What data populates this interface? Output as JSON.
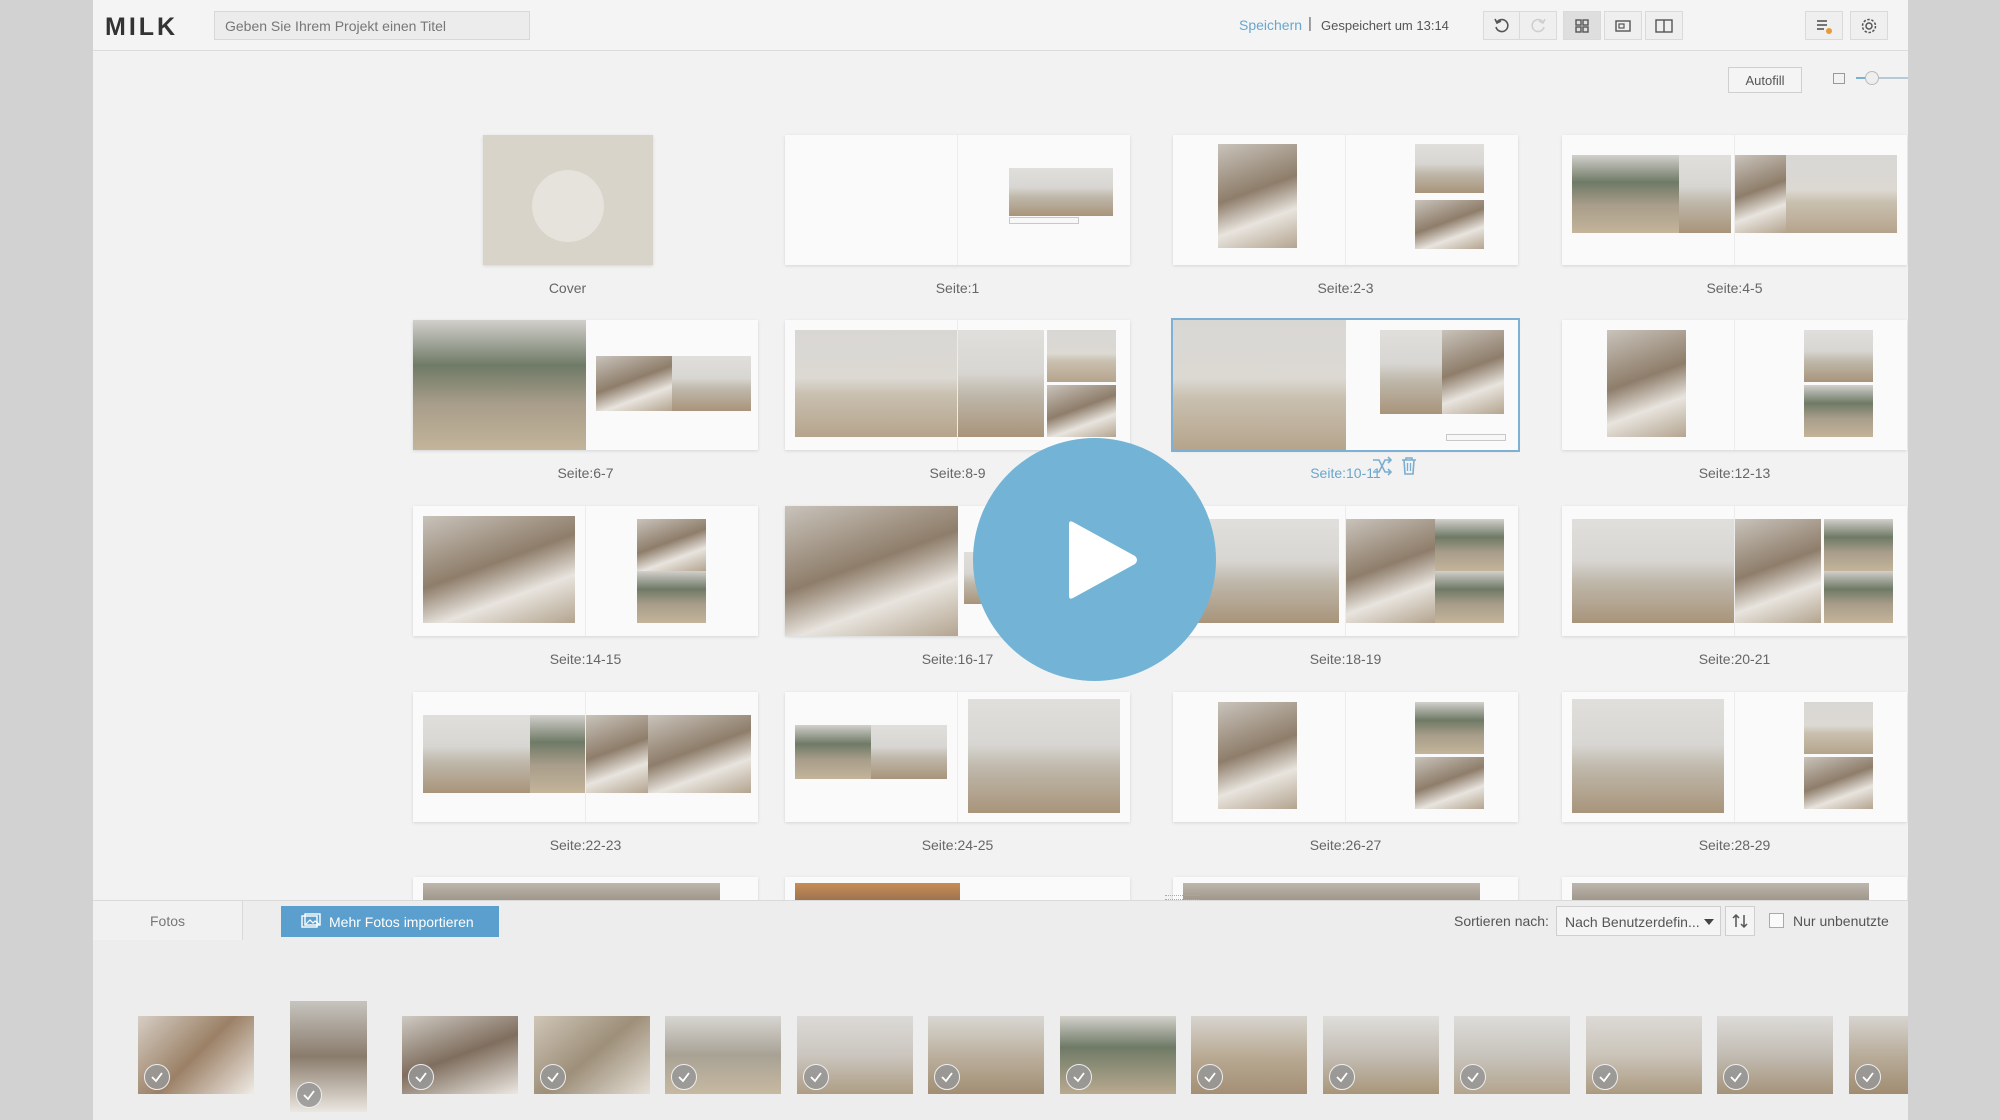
{
  "app": {
    "logo": "MILK",
    "title_placeholder": "Geben Sie Ihrem Projekt einen Titel",
    "save_label": "Speichern",
    "save_separator": "|",
    "saved_status": "Gespeichert um 13:14"
  },
  "toolbar": {
    "autofill_label": "Autofill",
    "zoom_level": 0.3
  },
  "spreads": [
    {
      "label": "Cover",
      "selected": false
    },
    {
      "label": "Seite:1",
      "selected": false
    },
    {
      "label": "Seite:2-3",
      "selected": false
    },
    {
      "label": "Seite:4-5",
      "selected": false
    },
    {
      "label": "Seite:6-7",
      "selected": false
    },
    {
      "label": "Seite:8-9",
      "selected": false
    },
    {
      "label": "Seite:10-11",
      "selected": true
    },
    {
      "label": "Seite:12-13",
      "selected": false
    },
    {
      "label": "Seite:14-15",
      "selected": false
    },
    {
      "label": "Seite:16-17",
      "selected": false
    },
    {
      "label": "Seite:18-19",
      "selected": false
    },
    {
      "label": "Seite:20-21",
      "selected": false
    },
    {
      "label": "Seite:22-23",
      "selected": false
    },
    {
      "label": "Seite:24-25",
      "selected": false
    },
    {
      "label": "Seite:26-27",
      "selected": false
    },
    {
      "label": "Seite:28-29",
      "selected": false
    }
  ],
  "panel": {
    "tab_label": "Fotos",
    "import_label": "Mehr Fotos importieren",
    "sort_label": "Sortieren nach:",
    "sort_value": "Nach Benutzerdefin...",
    "unused_only_label": "Nur unbenutzte",
    "unused_only_checked": false
  },
  "colors": {
    "accent": "#6aa6cc",
    "import_button": "#5a9fcd",
    "play_button": "#72b3d6",
    "selected_outline": "#7db0d4"
  },
  "icons": {
    "undo": "undo-icon",
    "redo": "redo-icon",
    "grid_view": "grid-view-icon",
    "single_view": "single-page-view-icon",
    "spread_view": "spread-view-icon",
    "list_settings": "list-settings-icon",
    "settings": "gear-icon",
    "share": "share-icon",
    "help": "help-icon",
    "play": "play-icon"
  }
}
